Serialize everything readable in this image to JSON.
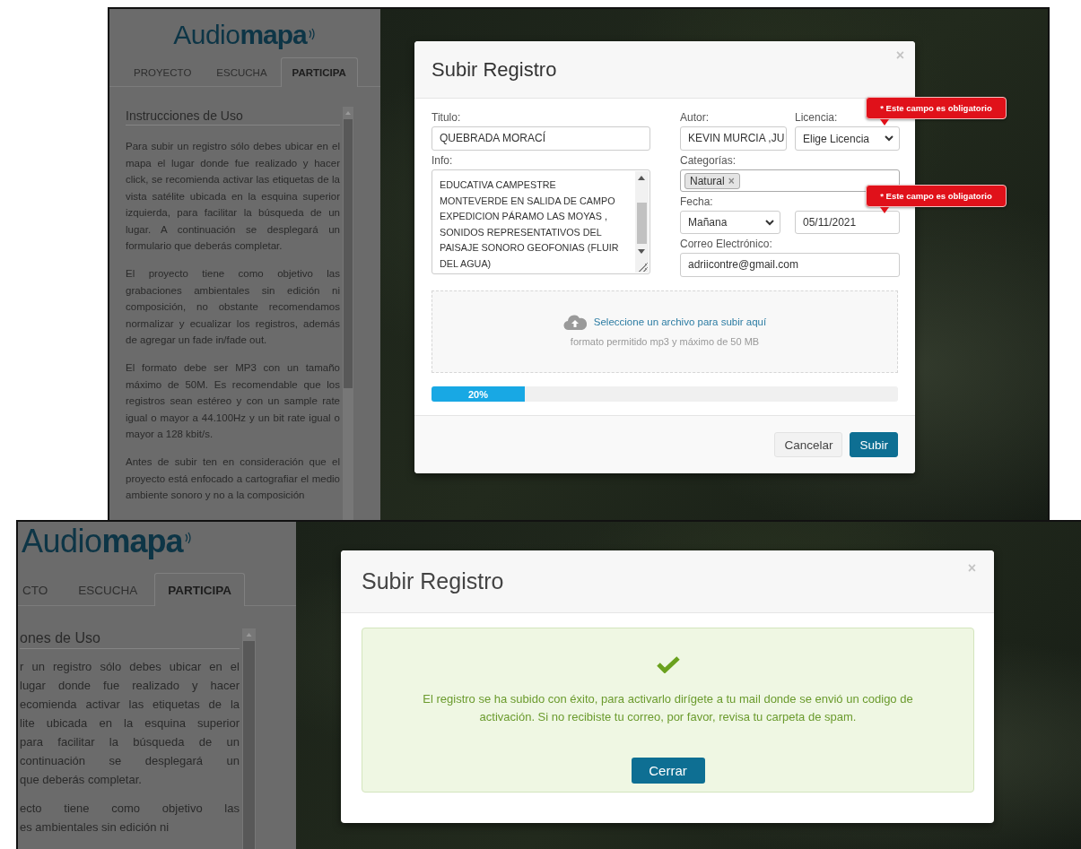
{
  "panels": [
    {
      "kind": "upload",
      "sidebar": {
        "logo": "Audio**mapa**",
        "tabs": [
          {
            "label": "PROYECTO",
            "selected": false
          },
          {
            "label": "ESCUCHA",
            "selected": false
          },
          {
            "label": "PARTICIPA",
            "selected": true
          }
        ],
        "heading": "Instrucciones de Uso",
        "paragraphs": [
          [
            "Para subir un registro sólo debes ubicar en el",
            "mapa el lugar donde fue realizado y hacer",
            "click, se recomienda activar las etiquetas de la",
            "vista satélite ubicada en la esquina superior",
            "izquierda, para facilitar la búsqueda de un",
            "lugar. A continuación se desplegará un",
            "formulario que deberás completar."
          ],
          [
            "El proyecto tiene como objetivo las",
            "grabaciones ambientales sin edición ni",
            "composición, no obstante recomendamos",
            "normalizar y ecualizar los registros, además",
            "de agregar un fade in/fade out."
          ],
          [
            "El formato debe ser MP3 con un tamaño",
            "máximo de 50M. Es recomendable que los",
            "registros sean estéreo y con un sample rate",
            "igual o mayor a 44.100Hz y un bit rate igual o",
            "mayor a 128 kbit/s."
          ],
          [
            "Antes de subir ten en consideración que el",
            "proyecto está enfocado a cartografiar el medio",
            "ambiente sonoro y no a la composición"
          ]
        ]
      },
      "dialog": {
        "title": "Subir Registro",
        "close": "×",
        "titulo": {
          "label": "Titulo:",
          "value": "QUEBRADA MORACÍ"
        },
        "info": {
          "label": "Info:",
          "value": "EDUCATIVA CAMPESTRE\nMONTEVERDE EN SALIDA DE CAMPO\nEXPEDICION PÁRAMO LAS MOYAS ,\nSONIDOS REPRESENTATIVOS DEL\nPAISAJE SONORO GEOFONIAS (FLUIR\nDEL AGUA)"
        },
        "autor": {
          "label": "Autor:",
          "value": "KEVIN MURCIA ,JU"
        },
        "licencia": {
          "label": "Licencia:",
          "value": "Elige Licencia",
          "error": "* Este campo es obligatorio"
        },
        "categorias": {
          "label": "Categorías:",
          "tags": [
            {
              "label": "Natural",
              "remove": "×"
            }
          ]
        },
        "fecha": {
          "label": "Fecha:",
          "period": "Mañana",
          "date": "05/11/2021",
          "error": "* Este campo es obligatorio"
        },
        "correo": {
          "label": "Correo Electrónico:",
          "value": "adriicontre@gmail.com"
        },
        "dropzone": {
          "link": "Seleccione un archivo para subir aquí",
          "hint": "formato permitido mp3 y máximo de 50 MB"
        },
        "progress": {
          "level": 0.2,
          "text": "20%"
        },
        "buttons": [
          {
            "label": "Cancelar",
            "kind": "cancel"
          },
          {
            "label": "Subir",
            "kind": "submit"
          }
        ]
      }
    },
    {
      "kind": "success",
      "sidebar": {
        "logo": "Audio**mapa**",
        "tabs": [
          {
            "label": "CTO",
            "selected": false
          },
          {
            "label": "ESCUCHA",
            "selected": false
          },
          {
            "label": "PARTICIPA",
            "selected": true
          }
        ],
        "heading": "ones de Uso",
        "paragraphs": [
          [
            "r un registro sólo debes ubicar en el",
            "lugar donde fue realizado y hacer",
            "ecomienda activar las etiquetas de la",
            "lite ubicada en la esquina superior",
            "para facilitar la búsqueda de un",
            "continuación se desplegará un",
            "que deberás completar."
          ],
          [
            "ecto tiene como objetivo las",
            "es ambientales sin edición ni"
          ]
        ]
      },
      "dialog": {
        "title": "Subir Registro",
        "close": "×",
        "message": "El registro se ha subido con éxito, para activarlo dirígete a tu mail donde se envió un codigo de activación. Si no recibiste tu correo, por favor, revisa tu carpeta de spam.",
        "button": "Cerrar"
      }
    }
  ]
}
